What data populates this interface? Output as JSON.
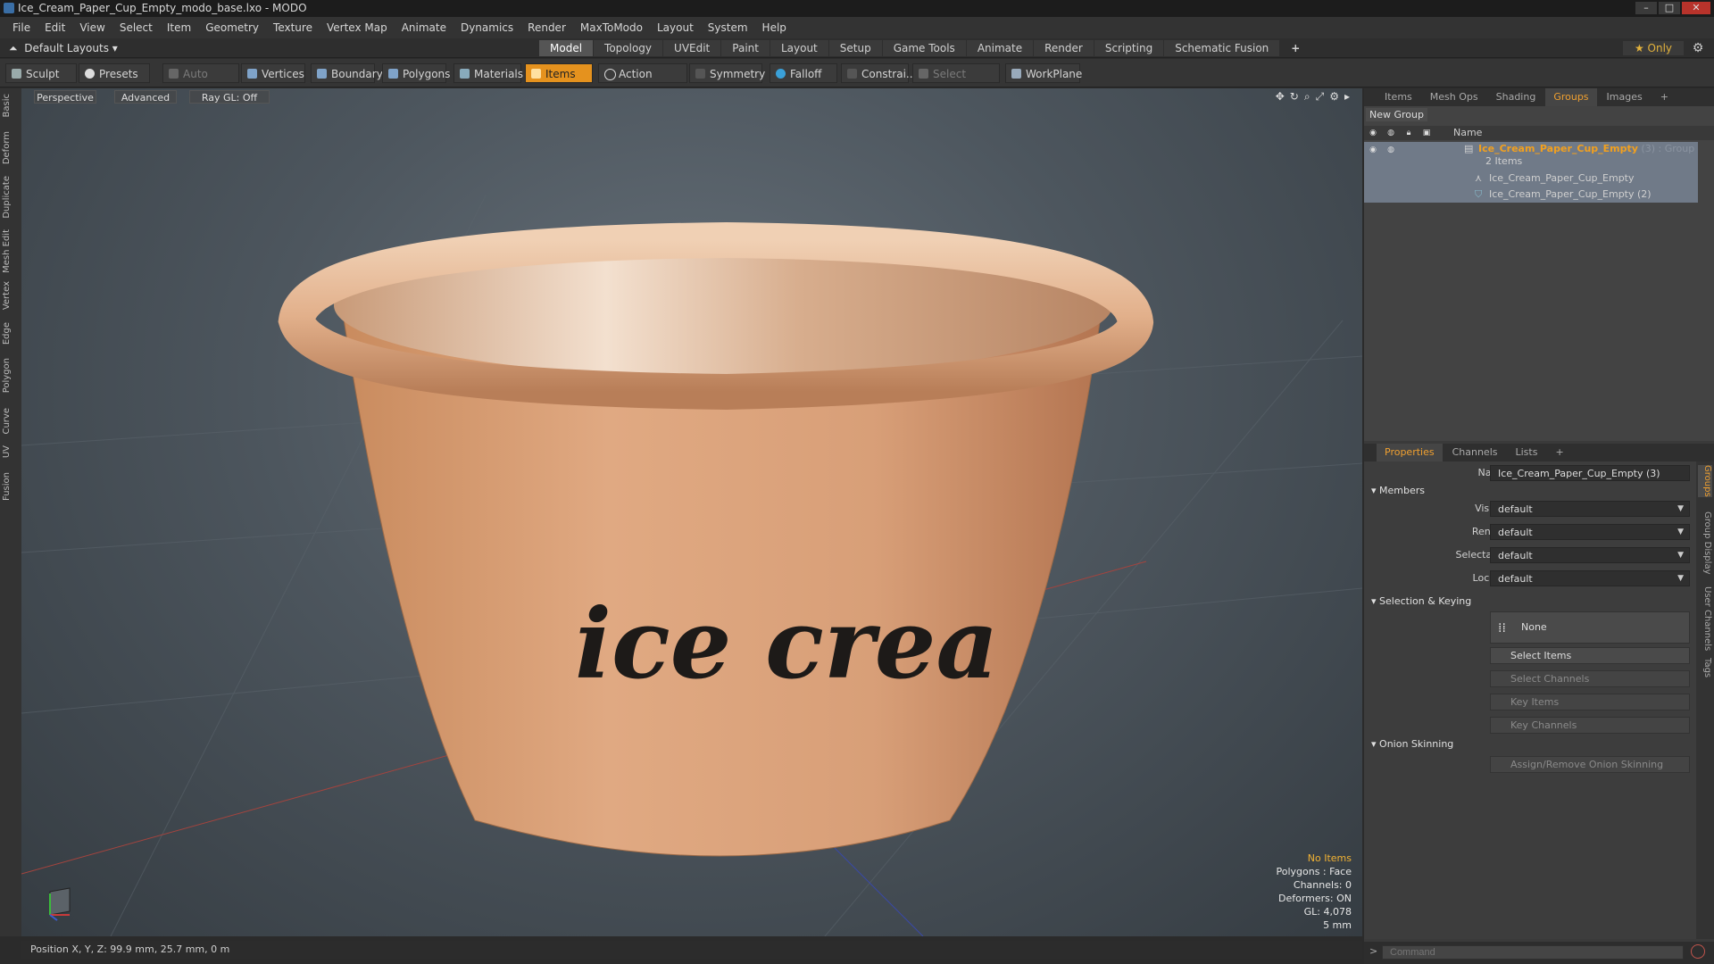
{
  "window": {
    "title": "Ice_Cream_Paper_Cup_Empty_modo_base.lxo - MODO"
  },
  "menu": [
    "File",
    "Edit",
    "View",
    "Select",
    "Item",
    "Geometry",
    "Texture",
    "Vertex Map",
    "Animate",
    "Dynamics",
    "Render",
    "MaxToModo",
    "Layout",
    "System",
    "Help"
  ],
  "layout": {
    "selector": "Default Layouts ▾",
    "tabs": [
      "Model",
      "Topology",
      "UVEdit",
      "Paint",
      "Layout",
      "Setup",
      "Game Tools",
      "Animate",
      "Render",
      "Scripting",
      "Schematic Fusion"
    ],
    "active_tab": "Model",
    "only_label": "★ Only"
  },
  "toolbar": {
    "sculpt": "Sculpt",
    "presets": "Presets",
    "auto_select": "Auto Select",
    "vertices": "Vertices",
    "boundary": "Boundary",
    "polygons": "Polygons",
    "materials": "Materials",
    "items": "Items",
    "action_center": "Action Center",
    "symmetry": "Symmetry",
    "falloff": "Falloff",
    "constraints": "Constrai...",
    "select_through": "Select Through",
    "workplane": "WorkPlane"
  },
  "left_tabs": [
    "Basic",
    "Deform",
    "Duplicate",
    "Mesh Edit",
    "Vertex",
    "Edge",
    "Polygon",
    "Curve",
    "UV",
    "Fusion"
  ],
  "viewport": {
    "view_mode": "Perspective",
    "shading": "Advanced",
    "raygl": "Ray GL: Off",
    "cup_text": "ice crea",
    "info": {
      "items": "No Items",
      "polygons": "Polygons : Face",
      "channels": "Channels: 0",
      "deformers": "Deformers: ON",
      "gl": "GL: 4,078",
      "scale": "5 mm"
    }
  },
  "status": {
    "position": "Position X, Y, Z:  99.9 mm, 25.7 mm, 0 m"
  },
  "items_panel": {
    "tabs": [
      "Items",
      "Mesh Ops",
      "Shading",
      "Groups",
      "Images"
    ],
    "active_tab": "Groups",
    "new_group": "New Group",
    "name_header": "Name",
    "root": {
      "name": "Ice_Cream_Paper_Cup_Empty",
      "type": "(3) : Group",
      "count": "2 Items"
    },
    "children": [
      "Ice_Cream_Paper_Cup_Empty",
      "Ice_Cream_Paper_Cup_Empty (2)"
    ]
  },
  "properties": {
    "tabs": [
      "Properties",
      "Channels",
      "Lists"
    ],
    "active_tab": "Properties",
    "name_label": "Name",
    "name_value": "Ice_Cream_Paper_Cup_Empty (3)",
    "members_section": "Members",
    "visible_label": "Visible",
    "visible_value": "default",
    "render_label": "Render",
    "render_value": "default",
    "selectable_label": "Selectable",
    "selectable_value": "default",
    "locked_label": "Locked",
    "locked_value": "default",
    "selection_section": "Selection & Keying",
    "none_label": "None",
    "select_items": "Select Items",
    "select_channels": "Select Channels",
    "key_items": "Key Items",
    "key_channels": "Key Channels",
    "onion_section": "Onion Skinning",
    "assign_onion": "Assign/Remove Onion Skinning",
    "side_tabs": [
      "Groups",
      "Group Display",
      "User Channels",
      "Tags"
    ]
  },
  "command": {
    "placeholder": "Command"
  }
}
